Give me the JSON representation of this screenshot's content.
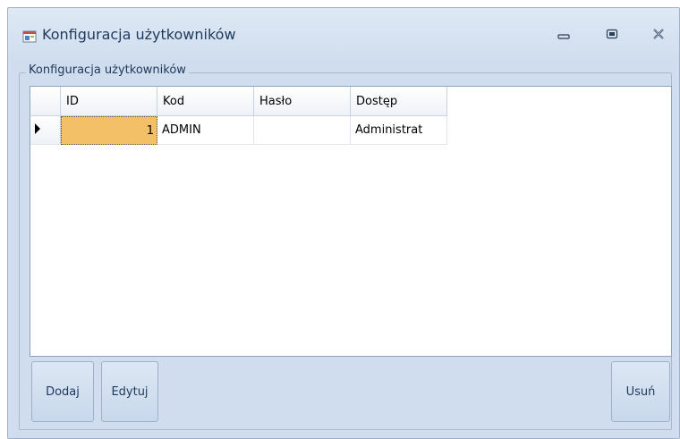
{
  "window": {
    "title": "Konfiguracja użytkowników"
  },
  "group": {
    "caption": "Konfiguracja użytkowników"
  },
  "grid": {
    "columns": [
      "ID",
      "Kod",
      "Hasło",
      "Dostęp"
    ],
    "rows": [
      {
        "id": "1",
        "kod": "ADMIN",
        "haslo": "",
        "dostep": "Administrat"
      }
    ]
  },
  "buttons": {
    "add": "Dodaj",
    "edit": "Edytuj",
    "delete": "Usuń"
  },
  "colors": {
    "window_bg": "#cfddee",
    "selected_cell": "#f3c067",
    "title_text": "#1e395b"
  },
  "icons": {
    "app": "app-window-icon",
    "minimize": "minimize-icon",
    "maximize": "maximize-icon",
    "close": "close-icon",
    "row_indicator": "row-indicator-arrow-icon"
  }
}
